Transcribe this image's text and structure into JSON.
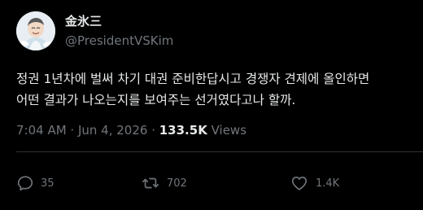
{
  "author": {
    "display_name": "金氷三",
    "handle": "@PresidentVSKim"
  },
  "post": {
    "lines": [
      "정권 1년차에 벌써 차기 대권 준비한답시고 경쟁자 견제에 올인하면",
      "어떤 결과가 나오는지를 보여주는 선거였다고나 할까."
    ],
    "time": "7:04 AM",
    "separator": " · ",
    "date": "Jun 4, 2026",
    "views_count": "133.5K",
    "views_label": " Views"
  },
  "actions": {
    "replies": "35",
    "reposts": "702",
    "likes": "1.4K"
  },
  "colors": {
    "background": "#000000",
    "text_primary": "#e7e9ea",
    "text_secondary": "#71767b",
    "divider": "#2f3336"
  },
  "icons": {
    "reply": "reply-bubble-icon",
    "repost": "repost-arrows-icon",
    "like": "heart-icon"
  }
}
